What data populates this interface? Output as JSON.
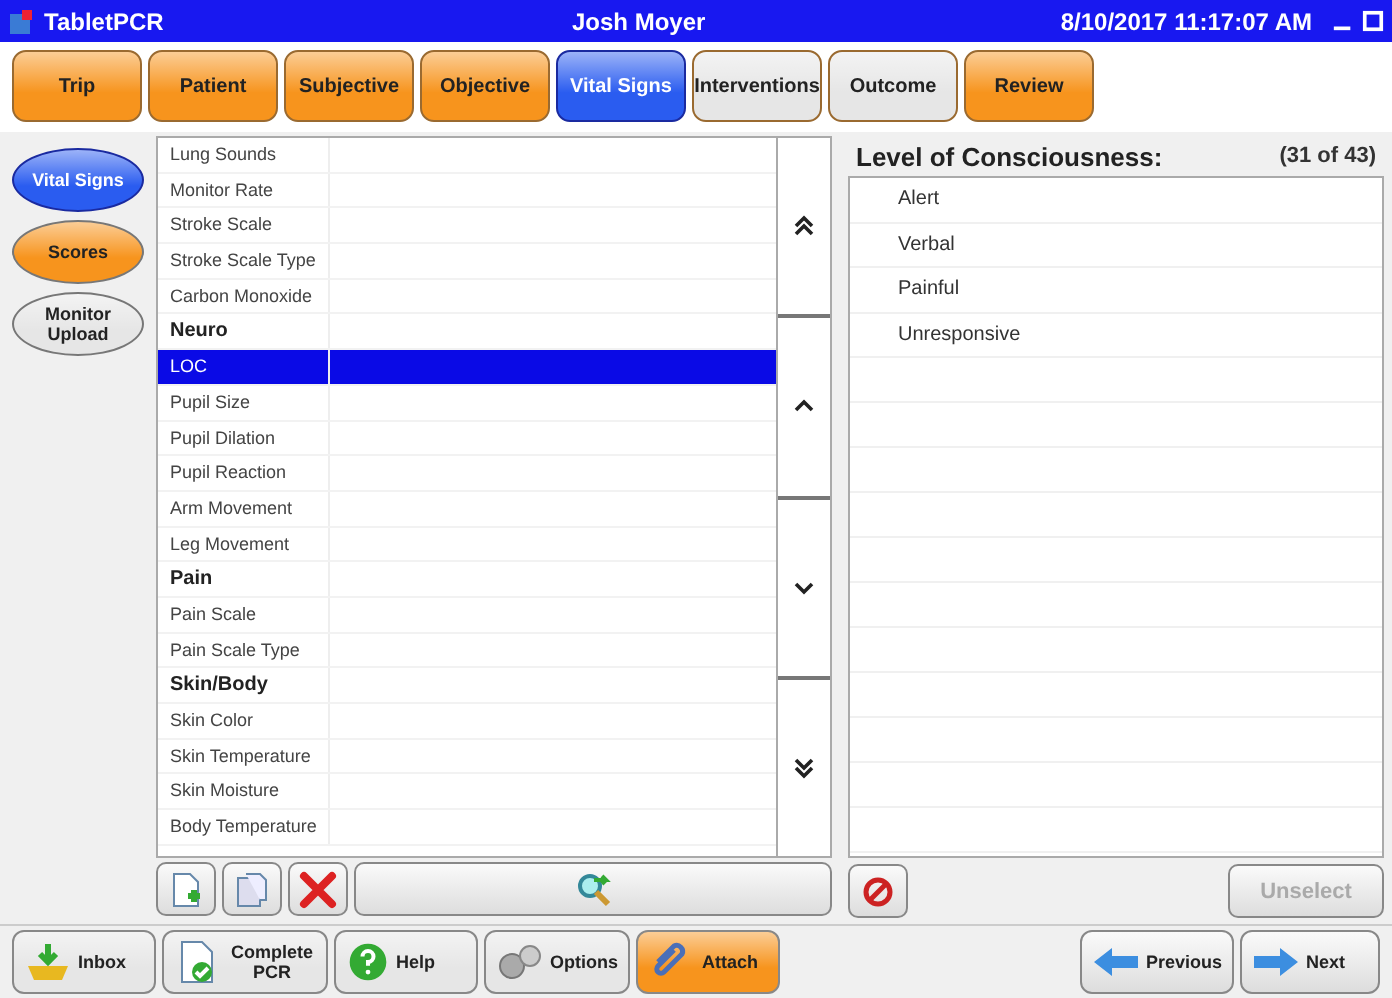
{
  "window": {
    "app": "TabletPCR",
    "user": "Josh Moyer",
    "datetime": "8/10/2017 11:17:07 AM"
  },
  "tabs": [
    {
      "label": "Trip",
      "selected": false,
      "color": "#f7941d"
    },
    {
      "label": "Patient",
      "selected": false,
      "color": "#f7941d"
    },
    {
      "label": "Subjective",
      "selected": false,
      "color": "#f7941d"
    },
    {
      "label": "Objective",
      "selected": false,
      "color": "#f7941d"
    },
    {
      "label": "Vital Signs",
      "selected": true,
      "color": "#2a5cf0"
    },
    {
      "label": "Interventions",
      "selected": false,
      "color": "#e6e6e6"
    },
    {
      "label": "Outcome",
      "selected": false,
      "color": "#e6e6e6"
    },
    {
      "label": "Review",
      "selected": false,
      "color": "#f7941d"
    }
  ],
  "side_tabs": [
    {
      "label": "Vital Signs",
      "selected": true,
      "color": "#2a5cf0"
    },
    {
      "label": "Scores",
      "selected": false,
      "color": "#f7941d"
    },
    {
      "label": "Monitor Upload",
      "selected": false,
      "color": "#e6e6e6"
    }
  ],
  "fields": [
    {
      "kind": "item",
      "label": "Lung Sounds",
      "selected": false
    },
    {
      "kind": "item",
      "label": "Monitor Rate",
      "selected": false
    },
    {
      "kind": "item",
      "label": "Stroke Scale",
      "selected": false
    },
    {
      "kind": "item",
      "label": "Stroke Scale Type",
      "selected": false
    },
    {
      "kind": "item",
      "label": "Carbon Monoxide",
      "selected": false
    },
    {
      "kind": "header",
      "label": "Neuro",
      "selected": false
    },
    {
      "kind": "item",
      "label": "LOC",
      "selected": true
    },
    {
      "kind": "item",
      "label": "Pupil Size",
      "selected": false
    },
    {
      "kind": "item",
      "label": "Pupil Dilation",
      "selected": false
    },
    {
      "kind": "item",
      "label": "Pupil Reaction",
      "selected": false
    },
    {
      "kind": "item",
      "label": "Arm Movement",
      "selected": false
    },
    {
      "kind": "item",
      "label": "Leg Movement",
      "selected": false
    },
    {
      "kind": "header",
      "label": "Pain",
      "selected": false
    },
    {
      "kind": "item",
      "label": "Pain Scale",
      "selected": false
    },
    {
      "kind": "item",
      "label": "Pain Scale Type",
      "selected": false
    },
    {
      "kind": "header",
      "label": "Skin/Body",
      "selected": false
    },
    {
      "kind": "item",
      "label": "Skin Color",
      "selected": false
    },
    {
      "kind": "item",
      "label": "Skin Temperature",
      "selected": false
    },
    {
      "kind": "item",
      "label": "Skin Moisture",
      "selected": false
    },
    {
      "kind": "item",
      "label": "Body Temperature",
      "selected": false
    }
  ],
  "panel": {
    "title": "Level of Consciousness:",
    "counter": "(31 of 43)",
    "options": [
      {
        "label": "Alert",
        "selected": false
      },
      {
        "label": "Verbal",
        "selected": false
      },
      {
        "label": "Painful",
        "selected": false
      },
      {
        "label": "Unresponsive",
        "selected": false
      }
    ],
    "unselect": {
      "label": "Unselect",
      "disabled": true
    }
  },
  "bottom_buttons": [
    {
      "label": "Inbox",
      "color": "#e6e6e6"
    },
    {
      "label": "Complete PCR",
      "color": "#e6e6e6"
    },
    {
      "label": "Help",
      "color": "#e6e6e6"
    },
    {
      "label": "Options",
      "color": "#e6e6e6"
    },
    {
      "label": "Attach",
      "color": "#f7941d"
    }
  ],
  "nav_buttons": [
    {
      "label": "Previous"
    },
    {
      "label": "Next"
    }
  ]
}
